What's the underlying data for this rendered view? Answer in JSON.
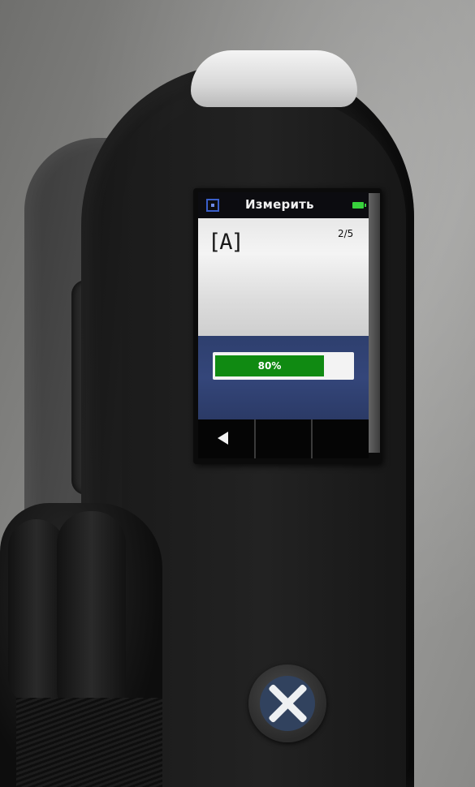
{
  "screen": {
    "title": "Измерить",
    "aperture_label": "[A]",
    "measurement_counter": "2/5",
    "progress": {
      "percent": 80,
      "label": "80%"
    },
    "softkeys": [
      {
        "icon": "back-arrow-icon"
      },
      {
        "icon": ""
      },
      {
        "icon": ""
      }
    ]
  },
  "icons": {
    "status_left": "target-icon",
    "status_right": "battery-icon",
    "measure_button": "x-icon"
  },
  "colors": {
    "status_bar": "#0c0c10",
    "content_bg": "#e8e8e8",
    "panel_bg": "#2e3f6e",
    "progress_fill": "#108a12",
    "battery": "#38d13c",
    "button_inner": "#31425e"
  }
}
